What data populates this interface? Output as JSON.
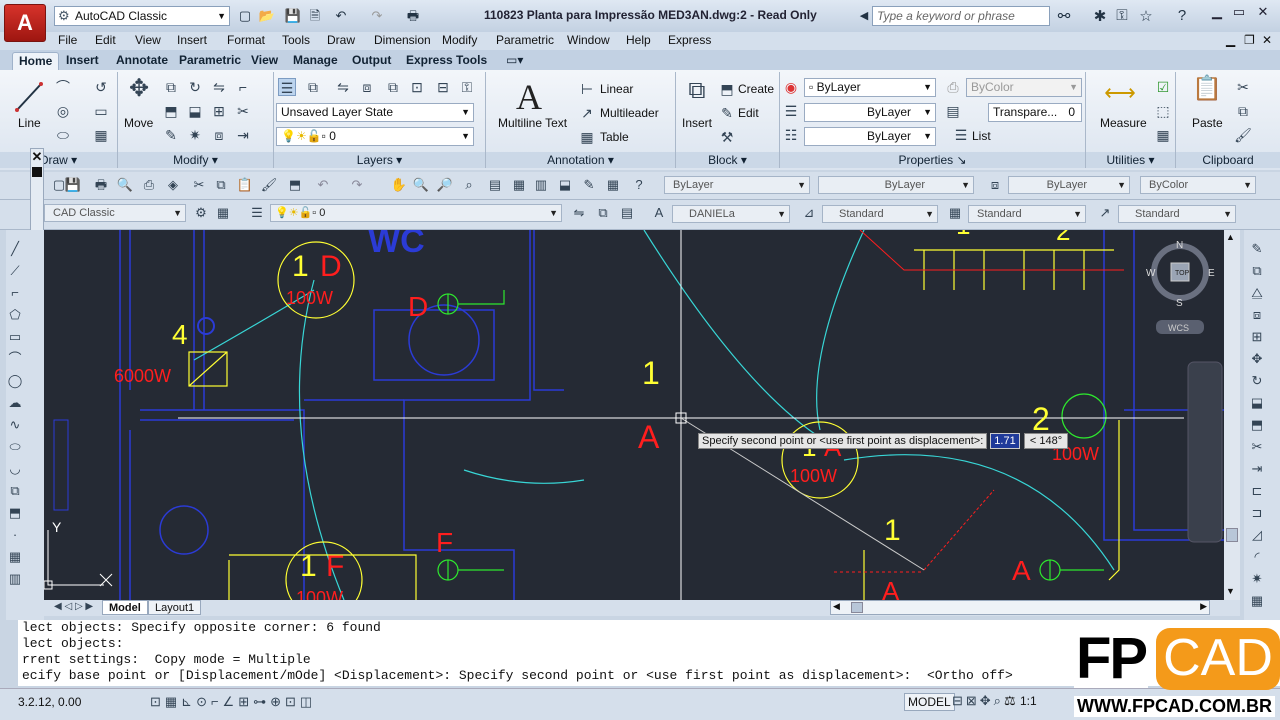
{
  "app": {
    "logo_letter": "A",
    "workspace": "AutoCAD Classic",
    "window_title": "110823 Planta para Impressão MED3AN.dwg:2 - Read Only",
    "search_placeholder": "Type a keyword or phrase"
  },
  "menu": [
    "File",
    "Edit",
    "View",
    "Insert",
    "Format",
    "Tools",
    "Draw",
    "Dimension",
    "Modify",
    "Parametric",
    "Window",
    "Help",
    "Express"
  ],
  "tabs": [
    "Home",
    "Insert",
    "Annotate",
    "Parametric",
    "View",
    "Manage",
    "Output",
    "Express Tools"
  ],
  "ribbon": {
    "draw": {
      "line_label": "Line",
      "panel_label": "Draw"
    },
    "modify": {
      "move_label": "Move",
      "panel_label": "Modify"
    },
    "layers": {
      "layer_state": "Unsaved Layer State",
      "current_layer": "0",
      "panel_label": "Layers"
    },
    "annotation": {
      "mtext_label": "Multiline Text",
      "linear": "Linear",
      "multileader": "Multileader",
      "table": "Table",
      "panel_label": "Annotation"
    },
    "block": {
      "insert": "Insert",
      "create": "Create",
      "edit": "Edit",
      "panel_label": "Block"
    },
    "properties": {
      "color": "ByLayer",
      "lineweight": "ByLayer",
      "linetype": "ByLayer",
      "plotstyle": "ByColor",
      "transparency_label": "Transpare...",
      "transparency_value": "0",
      "list": "List",
      "panel_label": "Properties"
    },
    "utilities": {
      "measure": "Measure",
      "panel_label": "Utilities"
    },
    "clipboard": {
      "paste": "Paste",
      "panel_label": "Clipboard"
    }
  },
  "toolbar1": {
    "color": "ByLayer",
    "linetype": "ByLayer",
    "lineweight": "ByLayer",
    "plotstyle": "ByColor"
  },
  "toolbar2": {
    "workspace": "CAD Classic",
    "layer": "0",
    "textstyle": "DANIELa",
    "dimstyle": "Standard",
    "tablestyle": "Standard",
    "mleaderstyle": "Standard"
  },
  "viewcube": {
    "north": "N",
    "south": "S",
    "east": "E",
    "west": "W",
    "top": "TOP",
    "ucs": "WCS"
  },
  "drawing_labels": {
    "circuit1_num": "1",
    "circuit1_letter": "D",
    "circuit1_power": "100W",
    "circuitF_num": "1",
    "circuitF_letter": "F",
    "circuitF_power": "100W",
    "switch_D": "D",
    "switch_F": "F",
    "switch_A": "A",
    "switch_A2": "A",
    "label4": "4",
    "power4": "6000W",
    "label1_mid": "1",
    "labelA_mid": "A",
    "label2": "2",
    "power2": "100W",
    "mid_circuit_num": "1",
    "mid_circuit_letter": "A",
    "mid_circuit_power": "100W",
    "wc_text": "WC",
    "tl_num": "1",
    "tr_num": "2",
    "bottom_num": "1",
    "bottom_A": "A",
    "ucs_y": "Y"
  },
  "tooltip": {
    "prompt": "Specify second point or <use first point as displacement>:",
    "distance": "1.71",
    "angle": "< 148°"
  },
  "layout_tabs": [
    "Model",
    "Layout1"
  ],
  "command_lines": [
    "lect objects: Specify opposite corner: 6 found",
    "lect objects:",
    "rrent settings:  Copy mode = Multiple",
    "ecify base point or [Displacement/mOde] <Displacement>: Specify second point or <use first point as displacement>:  <Ortho off>"
  ],
  "status": {
    "coords": "3.2.12, 0.00",
    "model": "MODEL",
    "scale": "1:1"
  },
  "watermark": {
    "brand_left": "FP",
    "brand_right": "CAD",
    "url": "WWW.FPCAD.COM.BR"
  },
  "colors": {
    "red": "#ff1e1e",
    "yellow": "#ffff33",
    "blue": "#2b3bd6",
    "cyan": "#38d6d6",
    "green": "#2ee82e",
    "bg": "#252a34"
  }
}
